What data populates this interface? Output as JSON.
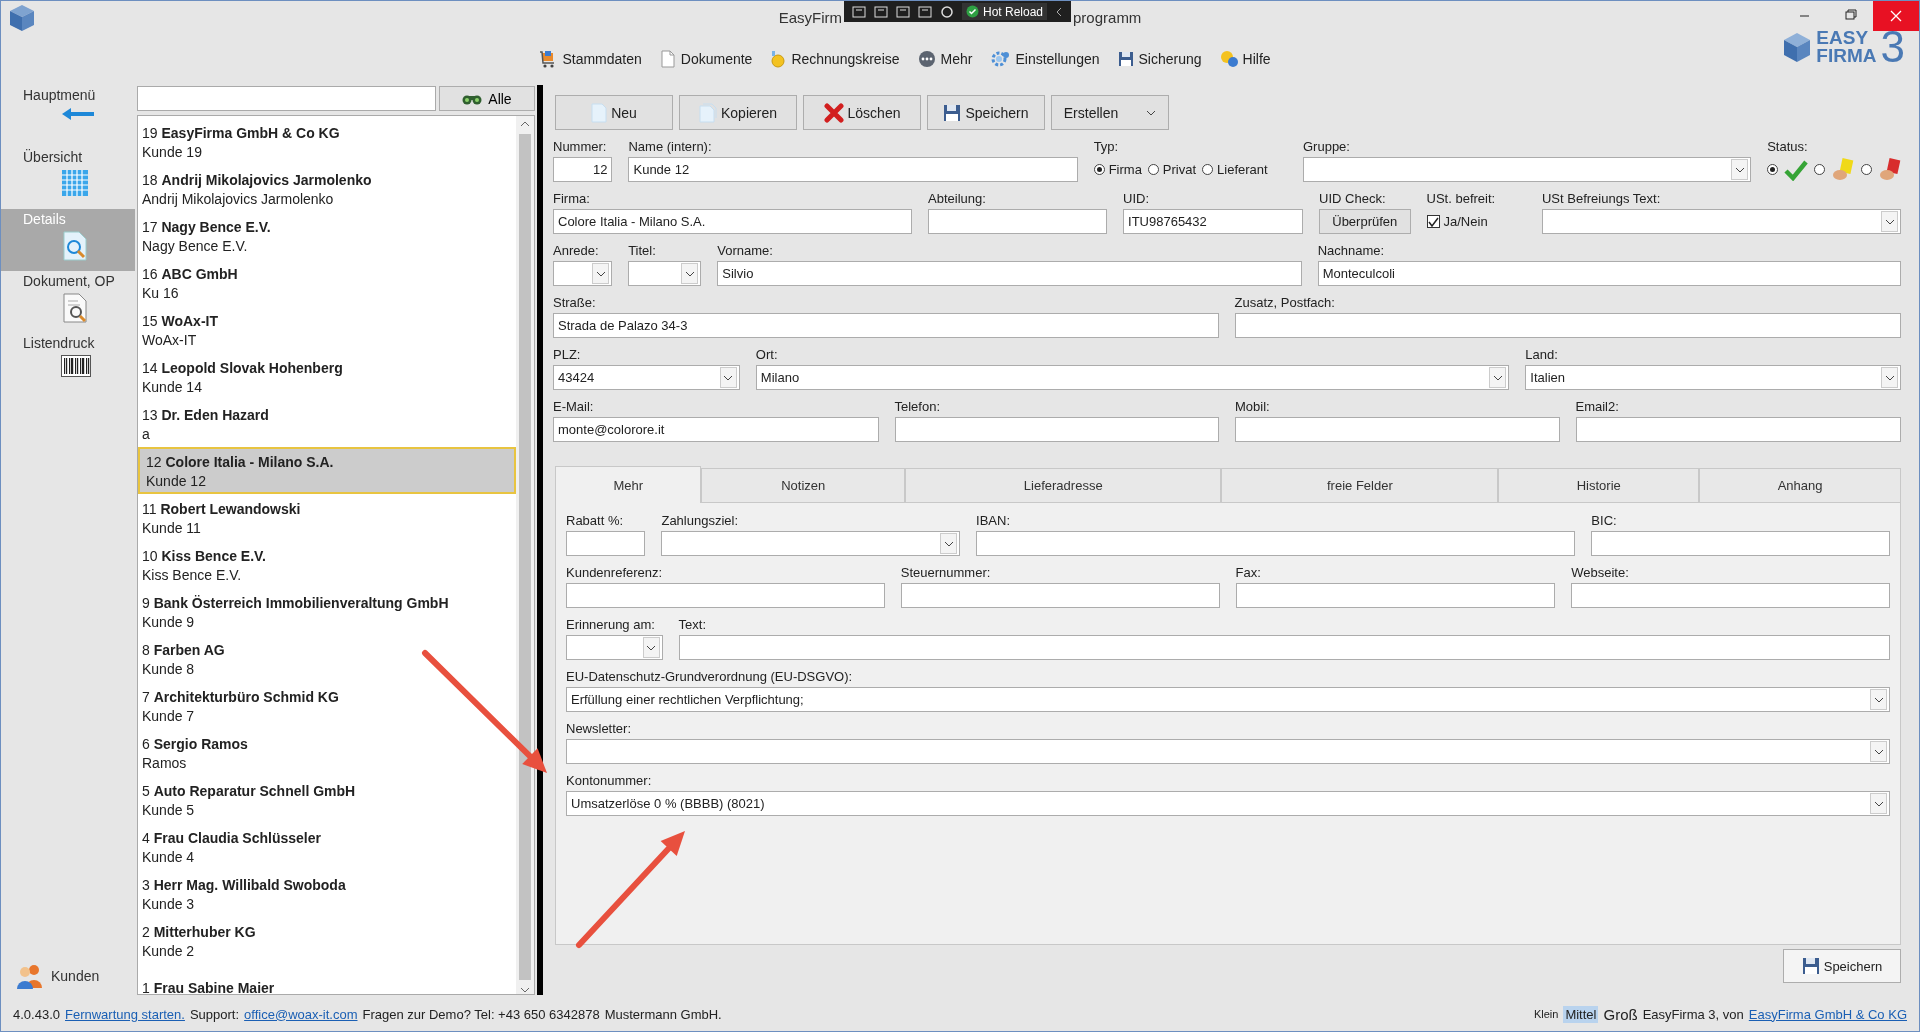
{
  "window": {
    "title_start": "EasyFirm",
    "title_end": "programm"
  },
  "debug_toolbar": {
    "label": "Hot Reload"
  },
  "menu": [
    {
      "label": "Stammdaten",
      "kind": "cart"
    },
    {
      "label": "Dokumente",
      "kind": "document"
    },
    {
      "label": "Rechnungskreise",
      "kind": "coin"
    },
    {
      "label": "Mehr",
      "kind": "more"
    },
    {
      "label": "Einstellungen",
      "kind": "gear"
    },
    {
      "label": "Sicherung",
      "kind": "disk"
    },
    {
      "label": "Hilfe",
      "kind": "help"
    }
  ],
  "logo": {
    "line1": "EASY",
    "line2": "FIRMA",
    "version": "3"
  },
  "nav": {
    "items": [
      {
        "label": "Hauptmenü",
        "kind": "back",
        "selected": false
      },
      {
        "label": "Übersicht",
        "kind": "grid",
        "selected": false
      },
      {
        "label": "Details",
        "kind": "details",
        "selected": true
      },
      {
        "label": "Dokument, OP",
        "kind": "document",
        "selected": false
      },
      {
        "label": "Listendruck",
        "kind": "barcode",
        "selected": false
      }
    ],
    "footer": "Kunden"
  },
  "search": {
    "button": "Alle"
  },
  "customers": [
    {
      "title": "19 **EasyFirma GmbH & Co KG**",
      "sub": "Kunde 19",
      "selected": false
    },
    {
      "title": "18 **Andrij Mikolajovics Jarmolenko**",
      "sub": "Andrij Mikolajovics Jarmolenko",
      "selected": false
    },
    {
      "title": "17 **Nagy Bence E.V.**",
      "sub": "Nagy Bence E.V.",
      "selected": false
    },
    {
      "title": "16 **ABC GmbH**",
      "sub": "Ku 16",
      "selected": false
    },
    {
      "title": "15 **WoAx-IT**",
      "sub": "WoAx-IT",
      "selected": false
    },
    {
      "title": "14 **Leopold Slovak Hohenberg**",
      "sub": "Kunde 14",
      "selected": false
    },
    {
      "title": "13 **Dr. Eden Hazard**",
      "sub": "a",
      "selected": false
    },
    {
      "title": "12 **Colore Italia - Milano S.A.**",
      "sub": "Kunde 12",
      "selected": true
    },
    {
      "title": "11 **Robert Lewandowski**",
      "sub": "Kunde 11",
      "selected": false
    },
    {
      "title": "10 **Kiss Bence E.V.**",
      "sub": "Kiss Bence E.V.",
      "selected": false
    },
    {
      "title": "9 **Bank Österreich Immobilienveraltung GmbH**",
      "sub": "Kunde 9",
      "selected": false
    },
    {
      "title": "8 **Farben AG**",
      "sub": "Kunde 8",
      "selected": false
    },
    {
      "title": "7 **Architekturbüro Schmid KG**",
      "sub": "Kunde 7",
      "selected": false
    },
    {
      "title": "6 **Sergio Ramos**",
      "sub": "Ramos",
      "selected": false
    },
    {
      "title": "5 **Auto Reparatur Schnell GmbH**",
      "sub": "Kunde 5",
      "selected": false
    },
    {
      "title": "4 **Frau Claudia Schlüsseler**",
      "sub": "Kunde 4",
      "selected": false
    },
    {
      "title": "3 **Herr Mag. Willibald Swoboda**",
      "sub": "Kunde 3",
      "selected": false
    },
    {
      "title": "2 **Mitterhuber KG**",
      "sub": "Kunde 2",
      "selected": false
    },
    {
      "title": "1 **Frau Sabine Maier**",
      "selected": false
    }
  ],
  "toolbar": [
    {
      "label": "Neu",
      "kind": "new"
    },
    {
      "label": "Kopieren",
      "kind": "copy"
    },
    {
      "label": "Löschen",
      "kind": "delete"
    },
    {
      "label": "Speichern",
      "kind": "save"
    },
    {
      "label": "Erstellen",
      "kind": "dropdown"
    }
  ],
  "form": {
    "rows": [
      {
        "fields": [
          {
            "kind": "number",
            "label": "Nummer:",
            "value": "12"
          },
          {
            "kind": "text",
            "label": "Name (intern):",
            "value": "Kunde 12"
          },
          {
            "kind": "radio",
            "label": "Typ:",
            "options": [
              {
                "label": "Firma",
                "selected": true
              },
              {
                "label": "Privat",
                "selected": false
              },
              {
                "label": "Lieferant",
                "selected": false
              }
            ]
          },
          {
            "kind": "select",
            "label": "Gruppe:"
          },
          {
            "kind": "status",
            "label": "Status:",
            "options": [
              {
                "kind": "ok",
                "selected": true
              },
              {
                "kind": "yellow",
                "selected": false
              },
              {
                "kind": "red",
                "selected": false
              }
            ]
          }
        ]
      },
      {
        "fields": [
          {
            "kind": "text",
            "label": "Firma:",
            "value": "Colore Italia - Milano S.A."
          },
          {
            "kind": "text",
            "label": "Abteilung:"
          },
          {
            "kind": "text",
            "label": "UID:",
            "value": "ITU98765432"
          },
          {
            "kind": "button",
            "label": "UID Check:",
            "button": "Überprüfen"
          },
          {
            "kind": "check",
            "label": "USt. befreit:",
            "text": "Ja/Nein",
            "checked": true
          },
          {
            "kind": "select",
            "label": "USt Befreiungs Text:"
          }
        ]
      },
      {
        "fields": [
          {
            "kind": "select",
            "label": "Anrede:"
          },
          {
            "kind": "select",
            "label": "Titel:"
          },
          {
            "kind": "text",
            "label": "Vorname:",
            "value": "Silvio"
          },
          {
            "kind": "text",
            "label": "Nachname:",
            "value": "Monteculcoli"
          }
        ]
      },
      {
        "fields": [
          {
            "kind": "text",
            "label": "Straße:",
            "value": "Strada de Palazo 34-3"
          },
          {
            "kind": "text",
            "label": "Zusatz, Postfach:"
          }
        ]
      },
      {
        "fields": [
          {
            "kind": "select",
            "label": "PLZ:",
            "value": "43424"
          },
          {
            "kind": "select",
            "label": "Ort:",
            "value": "Milano"
          },
          {
            "kind": "select",
            "label": "Land:",
            "value": "Italien"
          }
        ]
      },
      {
        "fields": [
          {
            "kind": "text",
            "label": "E-Mail:",
            "value": "monte@colorore.it"
          },
          {
            "kind": "text",
            "label": "Telefon:"
          },
          {
            "kind": "text",
            "label": "Mobil:"
          },
          {
            "kind": "text",
            "label": "Email2:"
          }
        ]
      }
    ]
  },
  "tabs": [
    {
      "label": "Mehr",
      "selected": true
    },
    {
      "label": "Notizen",
      "selected": false
    },
    {
      "label": "Lieferadresse",
      "selected": false
    },
    {
      "label": "freie Felder",
      "selected": false
    },
    {
      "label": "Historie",
      "selected": false
    },
    {
      "label": "Anhang",
      "selected": false
    }
  ],
  "tab_panel": {
    "rows": [
      {
        "fields": [
          {
            "kind": "text",
            "label": "Rabatt %:"
          },
          {
            "kind": "select",
            "label": "Zahlungsziel:"
          },
          {
            "kind": "text",
            "label": "IBAN:"
          },
          {
            "kind": "text",
            "label": "BIC:"
          }
        ]
      },
      {
        "fields": [
          {
            "kind": "text",
            "label": "Kundenreferenz:"
          },
          {
            "kind": "text",
            "label": "Steuernummer:"
          },
          {
            "kind": "text",
            "label": "Fax:"
          },
          {
            "kind": "text",
            "label": "Webseite:"
          }
        ]
      },
      {
        "fields": [
          {
            "kind": "select",
            "label": "Erinnerung am:"
          },
          {
            "kind": "text",
            "label": "Text:"
          }
        ]
      },
      {
        "fields": [
          {
            "kind": "select",
            "label": "EU-Datenschutz-Grundverordnung (EU-DSGVO):",
            "value": "Erfüllung einer rechtlichen Verpflichtung;"
          }
        ]
      },
      {
        "fields": [
          {
            "kind": "select",
            "label": "Newsletter:"
          }
        ]
      },
      {
        "fields": [
          {
            "kind": "select",
            "label": "Kontonummer:",
            "value": "Umsatzerlöse 0 % (BBBB) (8021)"
          }
        ]
      }
    ]
  },
  "save_button": {
    "label": "Speichern"
  },
  "status_bar": {
    "version": "4.0.43.0",
    "remote_link": "Fernwartung starten.",
    "support_label": "Support:",
    "email_link": "office@woax-it.com",
    "demo_text": "Fragen zur Demo? Tel: +43 650 6342878",
    "licensee": "Mustermann GmbH.",
    "sizes": [
      {
        "label": "Klein",
        "selected": false
      },
      {
        "label": "Mittel",
        "selected": true
      },
      {
        "label": "Groß",
        "selected": false
      }
    ],
    "credit": "EasyFirma 3, von",
    "vendor_link": "EasyFirma GmbH & Co KG"
  }
}
